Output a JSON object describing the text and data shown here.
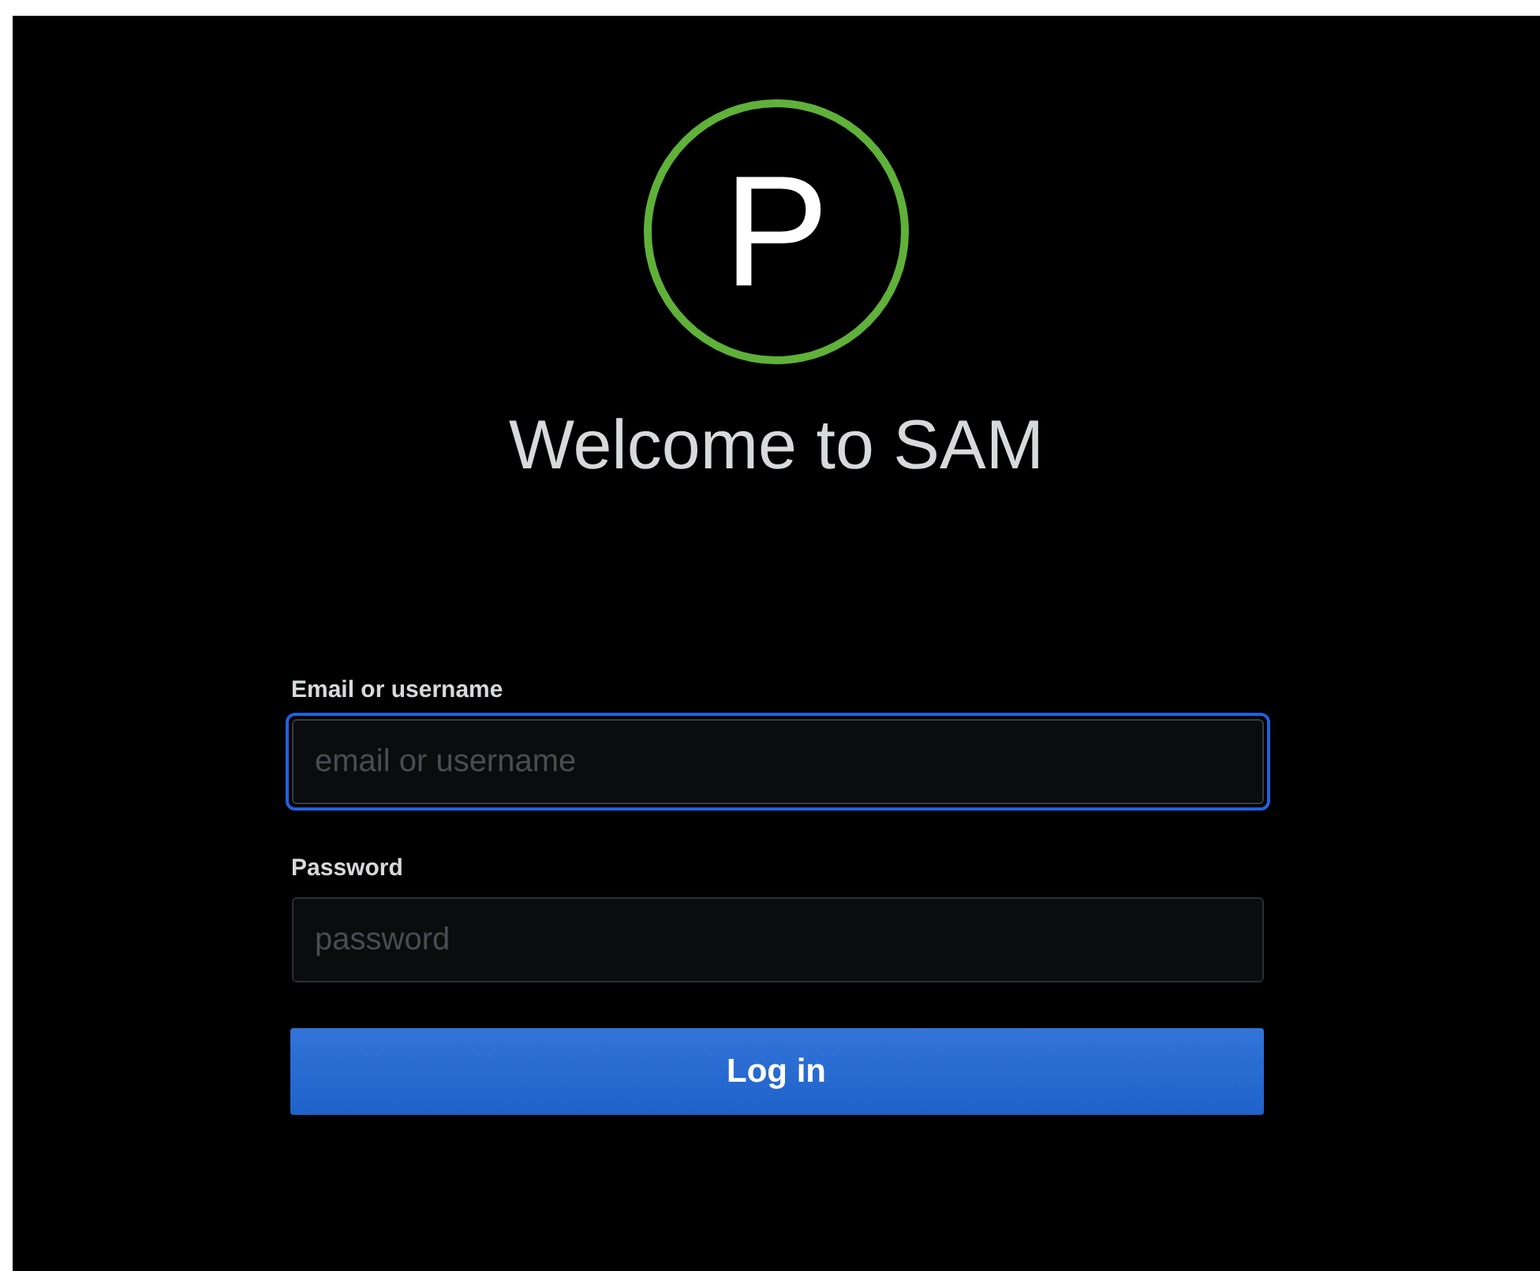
{
  "logo": {
    "letter": "P"
  },
  "title": "Welcome to SAM",
  "fields": [
    {
      "label": "Email or username",
      "placeholder": "email or username",
      "focused": true
    },
    {
      "label": "Password",
      "placeholder": "password",
      "focused": false
    }
  ],
  "button": {
    "label": "Log in"
  }
}
